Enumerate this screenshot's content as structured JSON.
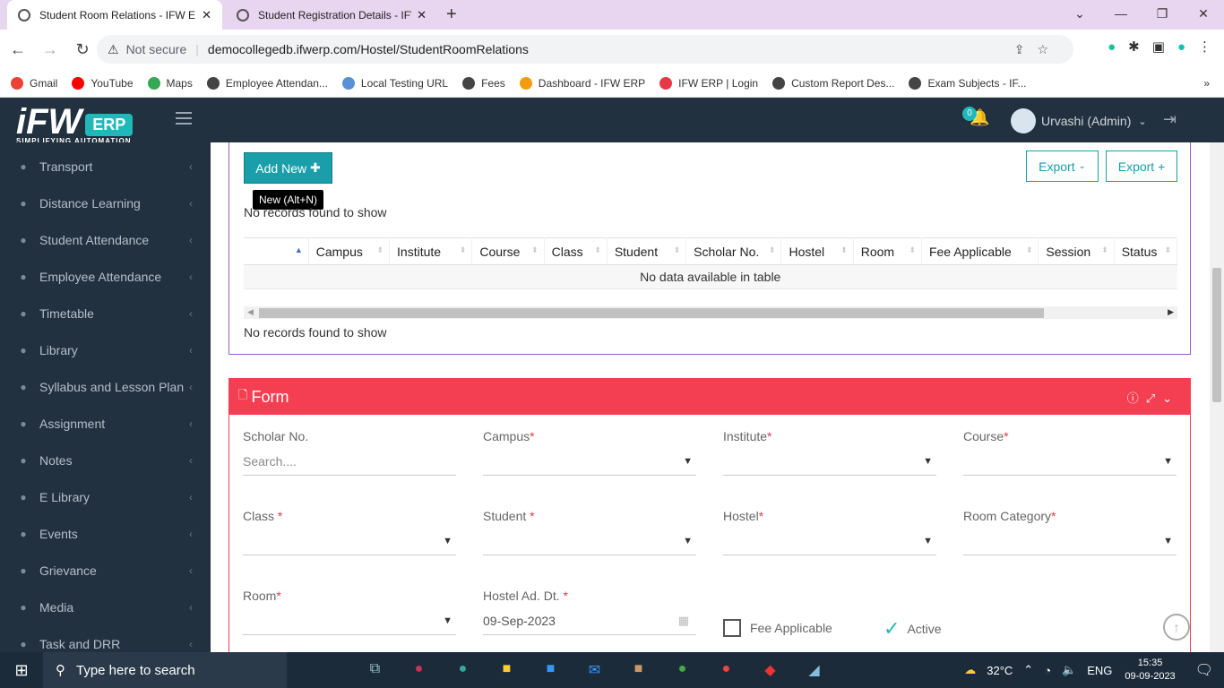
{
  "browser": {
    "tabs": [
      {
        "title": "Student Room Relations - IFW ERP",
        "active": true
      },
      {
        "title": "Student Registration Details - IFW ERP",
        "active": false
      }
    ],
    "window_controls": {
      "minimize": "—",
      "maximize": "❐",
      "close": "✕",
      "dropdown": "⌄"
    },
    "security": "Not secure",
    "url": "democollegedb.ifwerp.com/Hostel/StudentRoomRelations",
    "bookmarks": [
      "Gmail",
      "YouTube",
      "Maps",
      "Employee Attendan...",
      "Local Testing URL",
      "Fees",
      "Dashboard - IFW ERP",
      "IFW ERP | Login",
      "Custom Report Des...",
      "Exam Subjects - IF..."
    ],
    "bookmark_colors": [
      "#ea4335",
      "#ff0000",
      "#34a853",
      "#444444",
      "#5b8fd6",
      "#444444",
      "#f39c12",
      "#e53946",
      "#444444",
      "#444444"
    ],
    "bookmarks_more": "»"
  },
  "app": {
    "logo_main": "iFW",
    "logo_badge": "ERP",
    "logo_tagline": "SIMPLIFYING AUTOMATION",
    "notification_count": "0",
    "user_name": "Urvashi (Admin)"
  },
  "sidebar": {
    "items": [
      {
        "label": "Transport",
        "icon": "bus-icon"
      },
      {
        "label": "Distance Learning",
        "icon": "globe-icon"
      },
      {
        "label": "Student Attendance",
        "icon": "hand-icon"
      },
      {
        "label": "Employee Attendance",
        "icon": "clock-icon"
      },
      {
        "label": "Timetable",
        "icon": "history-icon"
      },
      {
        "label": "Library",
        "icon": "book-icon"
      },
      {
        "label": "Syllabus and Lesson Plan",
        "icon": "puzzle-icon"
      },
      {
        "label": "Assignment",
        "icon": "upload-icon"
      },
      {
        "label": "Notes",
        "icon": "list-icon"
      },
      {
        "label": "E Library",
        "icon": "megaphone-icon"
      },
      {
        "label": "Events",
        "icon": "trophy-icon"
      },
      {
        "label": "Grievance",
        "icon": "gavel-icon"
      },
      {
        "label": "Media",
        "icon": "eye-icon"
      },
      {
        "label": "Task and DRR",
        "icon": "tasks-icon"
      }
    ]
  },
  "list": {
    "add_new_label": "Add New",
    "tooltip": "New (Alt+N)",
    "export_label": "Export",
    "export_plus_label": "Export +",
    "no_records_top": "No records found to show",
    "no_records_bottom": "No records found to show",
    "columns": [
      "",
      "Campus",
      "Institute",
      "Course",
      "Class",
      "Student",
      "Scholar No.",
      "Hostel",
      "Room",
      "Fee Applicable",
      "Session",
      "Status"
    ],
    "empty_message": "No data available in table"
  },
  "form": {
    "title": "Form",
    "fields": {
      "scholar_no": {
        "label": "Scholar No.",
        "placeholder": "Search...."
      },
      "campus": {
        "label": "Campus"
      },
      "institute": {
        "label": "Institute"
      },
      "course": {
        "label": "Course"
      },
      "class": {
        "label": "Class"
      },
      "student": {
        "label": "Student"
      },
      "hostel": {
        "label": "Hostel"
      },
      "room_category": {
        "label": "Room Category"
      },
      "room": {
        "label": "Room"
      },
      "hostel_ad_dt": {
        "label": "Hostel Ad. Dt.",
        "value": "09-Sep-2023"
      }
    },
    "fee_applicable_label": "Fee Applicable",
    "active_label": "Active",
    "required_mark": "*"
  },
  "taskbar": {
    "search_placeholder": "Type here to search",
    "weather": "32°C",
    "language": "ENG",
    "time": "15:35",
    "date": "09-09-2023"
  }
}
